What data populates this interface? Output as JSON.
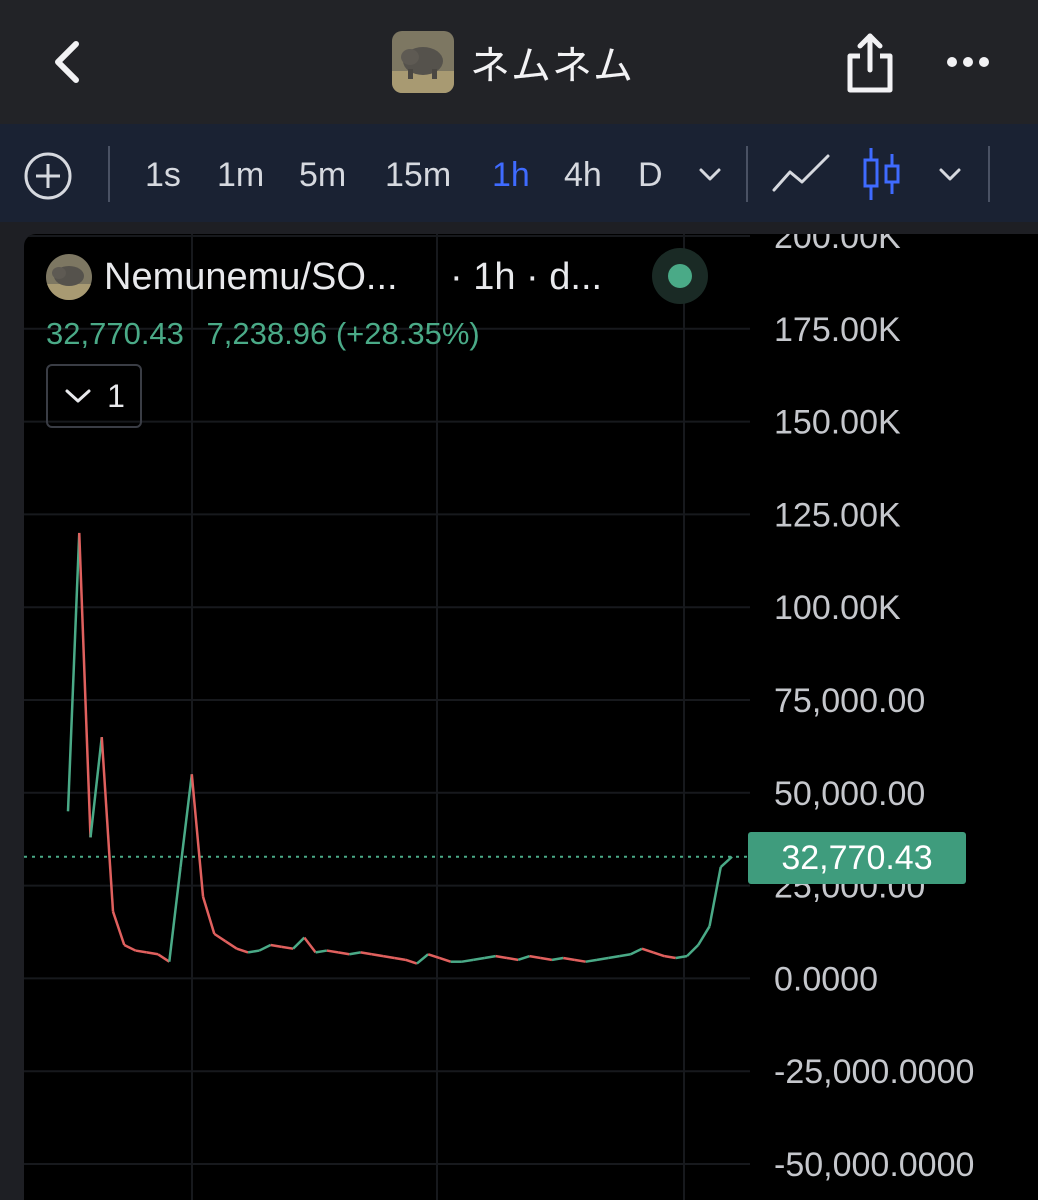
{
  "header": {
    "title": "ネムネム"
  },
  "toolbar": {
    "timeframes": [
      {
        "label": "1s",
        "active": false
      },
      {
        "label": "1m",
        "active": false
      },
      {
        "label": "5m",
        "active": false
      },
      {
        "label": "15m",
        "active": false
      },
      {
        "label": "1h",
        "active": true
      },
      {
        "label": "4h",
        "active": false
      },
      {
        "label": "D",
        "active": false
      }
    ],
    "chart_type_selected": "candlestick-icon"
  },
  "legend": {
    "pair": "Nemunemu/SO...",
    "interval": "· 1h · d...",
    "last_price": "32,770.43",
    "change": "7,238.96 (+28.35%)",
    "indicator_count": "1",
    "status": "live"
  },
  "price_tag": "32,770.43",
  "icons": {
    "back": "chevron-left-icon",
    "share": "share-icon",
    "more": "more-icon",
    "add": "add-indicator-icon",
    "line": "line-chart-icon",
    "candle": "candlestick-icon"
  },
  "colors": {
    "up": "#4aaa87",
    "down": "#e0605e",
    "active_tab": "#3f6bff",
    "price_tag": "#3f9c7d"
  },
  "chart_data": {
    "type": "line",
    "title": "",
    "xlabel": "",
    "ylabel": "",
    "ylim": [
      -50000,
      200000
    ],
    "y_ticks": [
      {
        "value": 200000,
        "label": "200.00K"
      },
      {
        "value": 175000,
        "label": "175.00K"
      },
      {
        "value": 150000,
        "label": "150.00K"
      },
      {
        "value": 125000,
        "label": "125.00K"
      },
      {
        "value": 100000,
        "label": "100.00K"
      },
      {
        "value": 75000,
        "label": "75,000.00"
      },
      {
        "value": 50000,
        "label": "50,000.00"
      },
      {
        "value": 25000,
        "label": "25,000.00"
      },
      {
        "value": 0,
        "label": "0.0000"
      },
      {
        "value": -25000,
        "label": "-25,000.0000"
      },
      {
        "value": -50000,
        "label": "-50,000.0000"
      }
    ],
    "last_price_line": 32770.43,
    "grid": true,
    "series": [
      {
        "values": [
          45000,
          120000,
          38000,
          65000,
          18000,
          9000,
          7500,
          7000,
          6500,
          4500,
          30000,
          55000,
          22000,
          12000,
          10000,
          8000,
          7000,
          7500,
          9000,
          8500,
          8000,
          11000,
          7000,
          7500,
          7000,
          6500,
          7000,
          6500,
          6000,
          5500,
          5000,
          4000,
          6500,
          5500,
          4500,
          4500,
          5000,
          5500,
          6000,
          5500,
          5000,
          6000,
          5500,
          5000,
          5500,
          5000,
          4500,
          5000,
          5500,
          6000,
          6500,
          8000,
          7000,
          6000,
          5500,
          6000,
          9000,
          14000,
          30000,
          32770
        ]
      }
    ]
  }
}
